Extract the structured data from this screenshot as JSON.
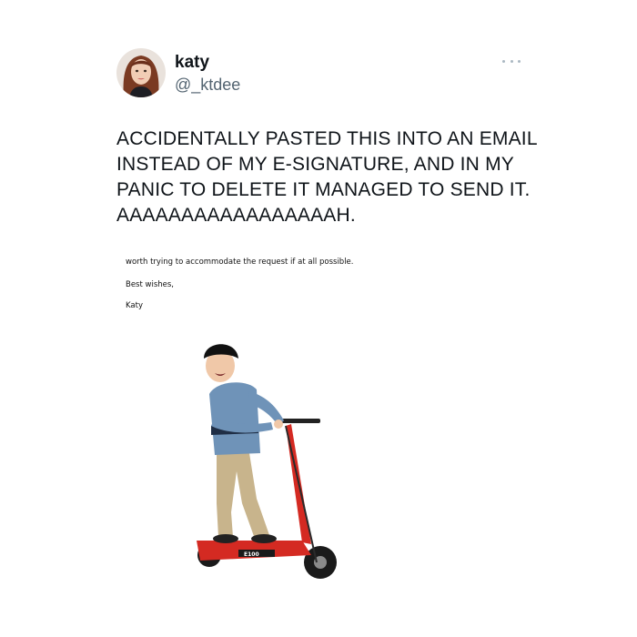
{
  "tweet": {
    "author": {
      "display_name": "katy",
      "handle": "@_ktdee",
      "avatar_icon": "profile-photo"
    },
    "more_icon": "more-dots-icon",
    "text": "ACCIDENTALLY PASTED THIS INTO AN EMAIL\nINSTEAD OF MY E-SIGNATURE, AND IN MY\nPANIC TO DELETE IT MANAGED TO SEND IT.\nAAAAAAAAAAAAAAAAAH."
  },
  "email": {
    "lines": [
      "worth trying to accommodate the request if at all possible.",
      "Best wishes,",
      "Katy"
    ],
    "image": {
      "subject": "boy-on-electric-scooter",
      "scooter_color": "#d42a22",
      "scooter_label": "E100"
    }
  },
  "colors": {
    "text": "#0f1419",
    "secondary_text": "#536471",
    "more_dots": "#aab8c2",
    "background": "#ffffff"
  }
}
